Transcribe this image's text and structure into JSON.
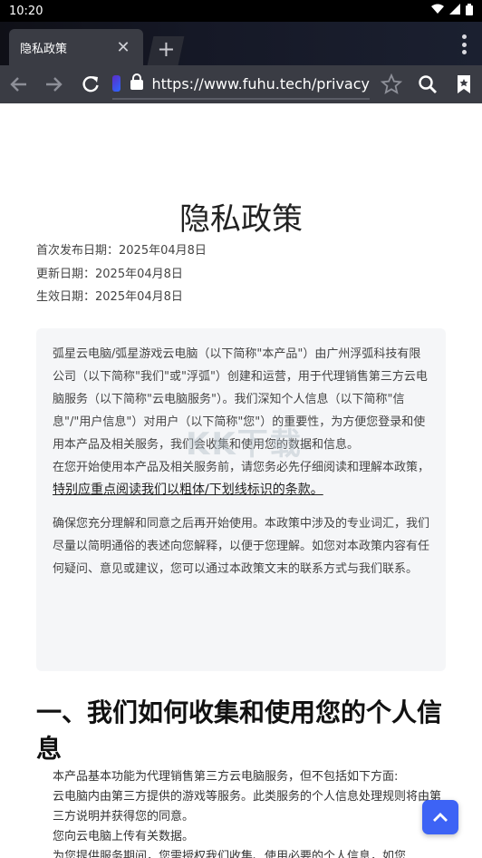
{
  "status_bar": {
    "time": "10:20"
  },
  "tab": {
    "title": "隐私政策"
  },
  "toolbar": {
    "url": "https://www.fuhu.tech/privacy"
  },
  "page": {
    "title": "隐私政策",
    "dates": [
      "首次发布日期：2025年04月8日",
      "更新日期：2025年04月8日",
      "生效日期：2025年04月8日"
    ],
    "box": {
      "p1": "弧星云电脑/弧星游戏云电脑（以下简称\"本产品\"）由广州浮弧科技有限公司（以下简称\"我们\"或\"浮弧\"）创建和运营，用于代理销售第三方云电脑服务（以下简称\"云电脑服务\"）。我们深知个人信息（以下简称\"信息\"/\"用户信息\"）对用户（以下简称\"您\"）的重要性，为方便您登录和使用本产品及相关服务，我们会收集和使用您的数据和信息。",
      "p2": "在您开始使用本产品及相关服务前，请您务必先仔细阅读和理解本政策，",
      "p3": "特别应重点阅读我们以粗体/下划线标识的条款。",
      "p4": "确保您充分理解和同意之后再开始使用。本政策中涉及的专业词汇，我们尽量以简明通俗的表述向您解释，以便于您理解。如您对本政策内容有任何疑问、意见或建议，您可以通过本政策文末的联系方式与我们联系。"
    },
    "section1": {
      "heading": "一、我们如何收集和使用您的个人信息",
      "lines": [
        "本产品基本功能为代理销售第三方云电脑服务，但不包括如下方面:",
        "云电脑内由第三方提供的游戏等服务。此类服务的个人信息处理规则将由第三方说明并获得您的同意。",
        "您向云电脑上传有关数据。",
        "为您提供服务期间，您需授权我们收集、使用必要的个人信息，如您"
      ]
    }
  },
  "colors": {
    "accent": "#3d63f5",
    "toolbar": "#3a3c44"
  }
}
